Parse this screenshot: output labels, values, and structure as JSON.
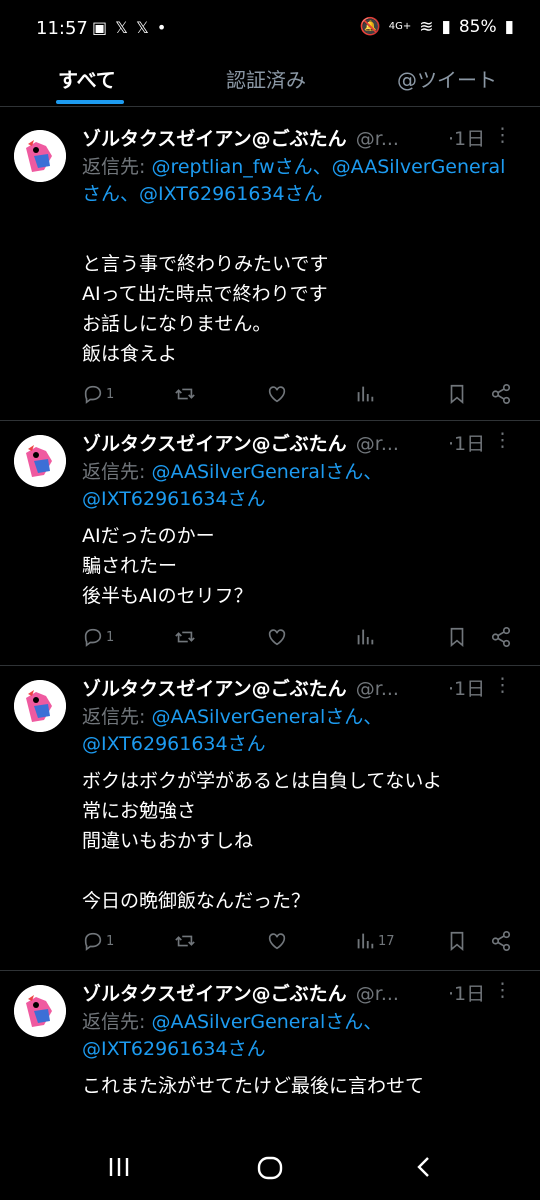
{
  "status_bar": {
    "time": "11:57",
    "network": "4G+",
    "battery": "85%"
  },
  "tabs": [
    {
      "label": "すべて",
      "active": true
    },
    {
      "label": "認証済み",
      "active": false
    },
    {
      "label": "@ツイート",
      "active": false
    }
  ],
  "tweets": [
    {
      "name": "ゾルタクスゼイアン@ごぶたん",
      "handle": "@r...",
      "time": "·1日",
      "reply_prefix": "返信先: ",
      "reply_mentions": "@reptlian_fwさん、@AASilverGeneralさん、@IXT62961634さん",
      "text": "と言う事で終わりみたいです\nAIって出た時点で終わりです\nお話しになりません。\n飯は食えよ",
      "reply_count": "1",
      "views": ""
    },
    {
      "name": "ゾルタクスゼイアン@ごぶたん",
      "handle": "@r...",
      "time": "·1日",
      "reply_prefix": "返信先: ",
      "reply_mentions": "@AASilverGeneralさん、@IXT62961634さん",
      "text": "AIだったのかー\n騙されたー\n後半もAIのセリフ？",
      "reply_count": "1",
      "views": ""
    },
    {
      "name": "ゾルタクスゼイアン@ごぶたん",
      "handle": "@r...",
      "time": "·1日",
      "reply_prefix": "返信先: ",
      "reply_mentions": "@AASilverGeneralさん、@IXT62961634さん",
      "text": "ボクはボクが学があるとは自負してないよ\n常にお勉強さ\n間違いもおかすしね\n\n今日の晩御飯なんだった？",
      "reply_count": "1",
      "views": "17"
    },
    {
      "name": "ゾルタクスゼイアン@ごぶたん",
      "handle": "@r...",
      "time": "·1日",
      "reply_prefix": "返信先: ",
      "reply_mentions": "@AASilverGeneralさん、@IXT62961634さん",
      "text": "これまた泳がせてたけど最後に言わせて",
      "reply_count": "",
      "views": ""
    }
  ],
  "colors": {
    "background": "#000000",
    "accent": "#1d9bf0",
    "muted": "#71767b",
    "divider": "#2f3336"
  },
  "icons": [
    "picture-icon",
    "x-logo-icon",
    "mute-icon",
    "wifi-icon",
    "signal-icon",
    "battery-icon",
    "reply-icon",
    "retweet-icon",
    "like-icon",
    "views-icon",
    "bookmark-icon",
    "share-icon",
    "more-icon",
    "recents-icon",
    "home-icon",
    "back-icon"
  ]
}
